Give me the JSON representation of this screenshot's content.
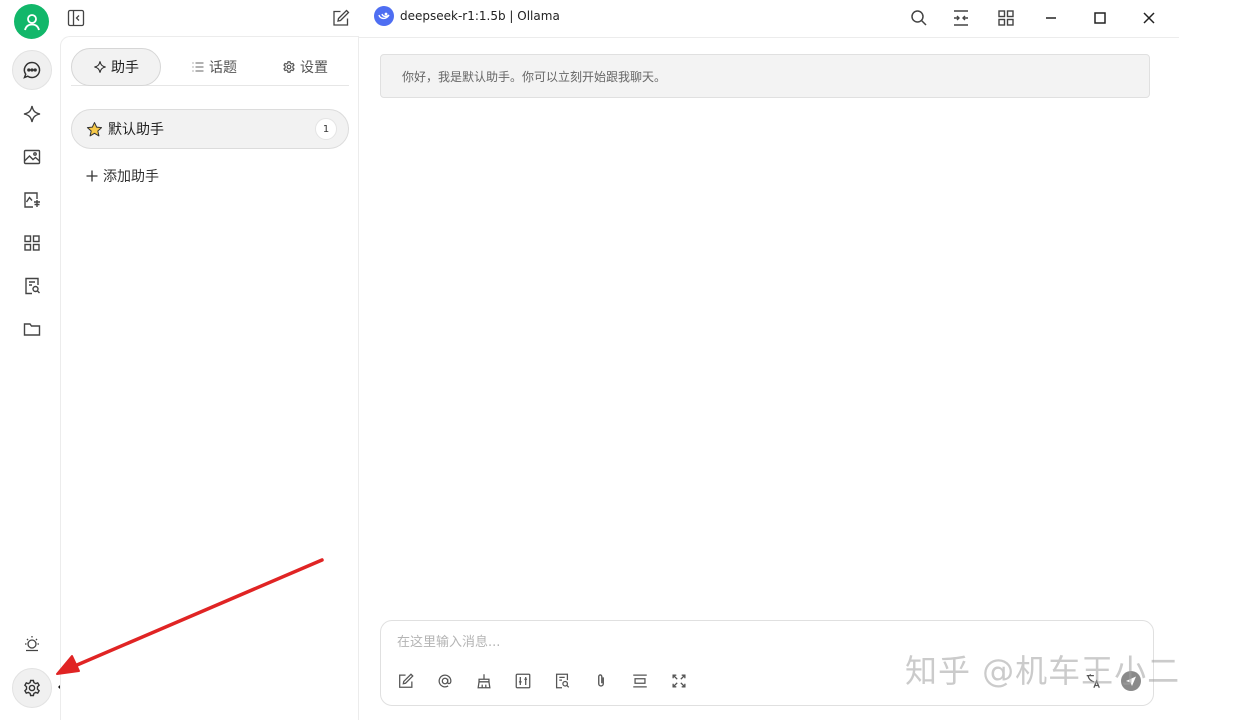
{
  "topbar": {
    "model_label": "deepseek-r1:1.5b | Ollama"
  },
  "panel": {
    "tabs": [
      {
        "label": "助手",
        "icon": "sparkle-icon",
        "active": true
      },
      {
        "label": "话题",
        "icon": "list-icon",
        "active": false
      },
      {
        "label": "设置",
        "icon": "gear-icon",
        "active": false
      }
    ],
    "assistant": {
      "name": "默认助手",
      "count": "1",
      "icon": "star-icon"
    },
    "add_label": "添加助手"
  },
  "chat": {
    "greeting": "你好，我是默认助手。你可以立刻开始跟我聊天。",
    "input_placeholder": "在这里输入消息..."
  },
  "rail": {
    "tooltip": "设置"
  },
  "watermark": "知乎 @机车王小二",
  "colors": {
    "avatar": "#12b76a",
    "model_logo": "#4e6ef2",
    "annotation_arrow": "#e02424"
  }
}
